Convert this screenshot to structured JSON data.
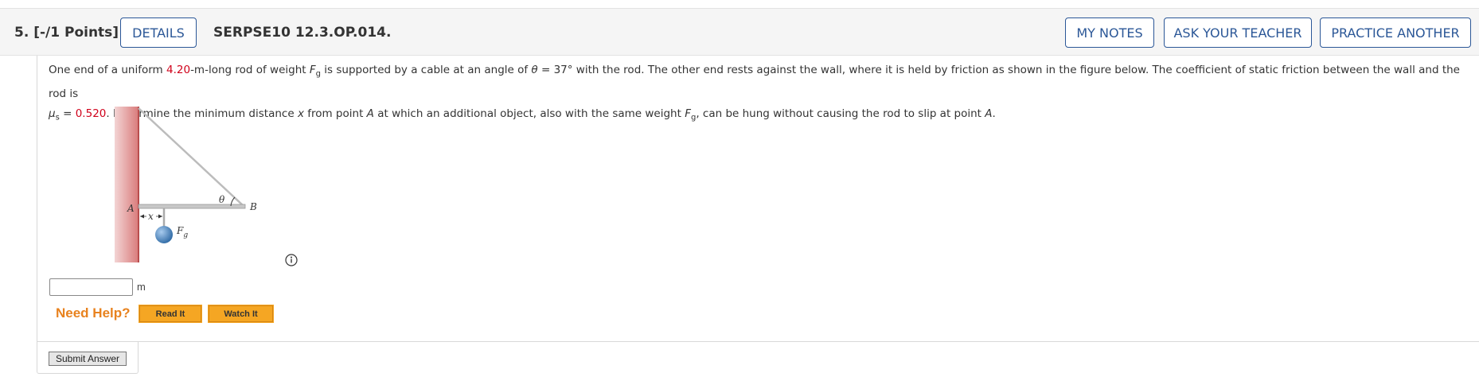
{
  "header": {
    "question_label": "5.  [-/1 Points]",
    "details_label": "DETAILS",
    "code": "SERPSE10 12.3.OP.014.",
    "my_notes_label": "MY NOTES",
    "ask_teacher_label": "ASK YOUR TEACHER",
    "practice_label": "PRACTICE ANOTHER"
  },
  "problem": {
    "p1": "One end of a uniform ",
    "length_value": "4.20",
    "p2": "-m-long rod of weight ",
    "F": "F",
    "g_sub": "g",
    "p3": " is supported by a cable at an angle of ",
    "theta": "θ",
    "p4": " = 37° with the rod. The other end rests against the wall, where it is held by friction as shown in the figure below. The coefficient of static friction between the wall and the rod is",
    "mu": "μ",
    "s_sub": "s",
    "p5": " = ",
    "mu_value": "0.520",
    "p6": ". Determine the minimum distance ",
    "x": "x",
    "p7": " from point ",
    "A": "A",
    "p8": " at which an additional object, also with the same weight ",
    "p9": ", can be hung without causing the rod to slip at point ",
    "p10": "."
  },
  "figure": {
    "label_A": "A",
    "label_B": "B",
    "label_theta": "θ",
    "label_x": "x",
    "label_F": "F",
    "label_g": "g"
  },
  "answer": {
    "value": "",
    "unit": "m"
  },
  "help": {
    "need_help": "Need Help?",
    "read_it": "Read It",
    "watch_it": "Watch It"
  },
  "submit_label": "Submit Answer",
  "colors": {
    "accent": "#2b5797",
    "value_red": "#d0021b",
    "help_orange": "#e8821e",
    "help_button": "#f5a623"
  }
}
